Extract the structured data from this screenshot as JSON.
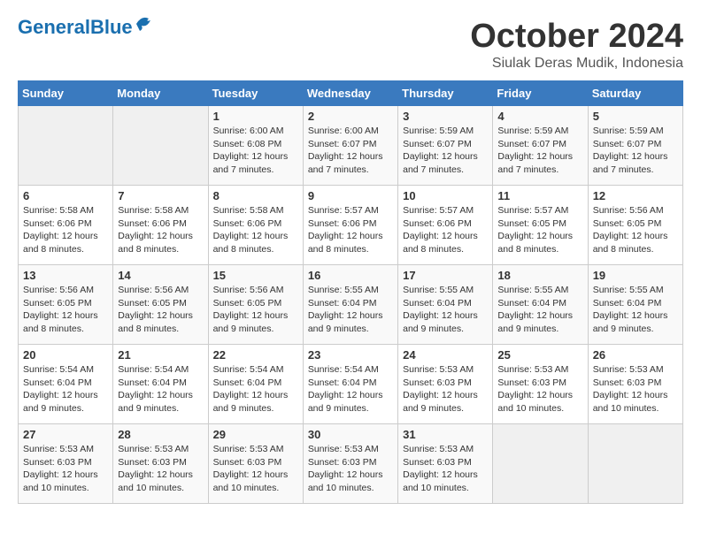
{
  "header": {
    "logo_general": "General",
    "logo_blue": "Blue",
    "month": "October 2024",
    "location": "Siulak Deras Mudik, Indonesia"
  },
  "weekdays": [
    "Sunday",
    "Monday",
    "Tuesday",
    "Wednesday",
    "Thursday",
    "Friday",
    "Saturday"
  ],
  "weeks": [
    [
      {
        "day": "",
        "sunrise": "",
        "sunset": "",
        "daylight": ""
      },
      {
        "day": "",
        "sunrise": "",
        "sunset": "",
        "daylight": ""
      },
      {
        "day": "1",
        "sunrise": "Sunrise: 6:00 AM",
        "sunset": "Sunset: 6:08 PM",
        "daylight": "Daylight: 12 hours and 7 minutes."
      },
      {
        "day": "2",
        "sunrise": "Sunrise: 6:00 AM",
        "sunset": "Sunset: 6:07 PM",
        "daylight": "Daylight: 12 hours and 7 minutes."
      },
      {
        "day": "3",
        "sunrise": "Sunrise: 5:59 AM",
        "sunset": "Sunset: 6:07 PM",
        "daylight": "Daylight: 12 hours and 7 minutes."
      },
      {
        "day": "4",
        "sunrise": "Sunrise: 5:59 AM",
        "sunset": "Sunset: 6:07 PM",
        "daylight": "Daylight: 12 hours and 7 minutes."
      },
      {
        "day": "5",
        "sunrise": "Sunrise: 5:59 AM",
        "sunset": "Sunset: 6:07 PM",
        "daylight": "Daylight: 12 hours and 7 minutes."
      }
    ],
    [
      {
        "day": "6",
        "sunrise": "Sunrise: 5:58 AM",
        "sunset": "Sunset: 6:06 PM",
        "daylight": "Daylight: 12 hours and 8 minutes."
      },
      {
        "day": "7",
        "sunrise": "Sunrise: 5:58 AM",
        "sunset": "Sunset: 6:06 PM",
        "daylight": "Daylight: 12 hours and 8 minutes."
      },
      {
        "day": "8",
        "sunrise": "Sunrise: 5:58 AM",
        "sunset": "Sunset: 6:06 PM",
        "daylight": "Daylight: 12 hours and 8 minutes."
      },
      {
        "day": "9",
        "sunrise": "Sunrise: 5:57 AM",
        "sunset": "Sunset: 6:06 PM",
        "daylight": "Daylight: 12 hours and 8 minutes."
      },
      {
        "day": "10",
        "sunrise": "Sunrise: 5:57 AM",
        "sunset": "Sunset: 6:06 PM",
        "daylight": "Daylight: 12 hours and 8 minutes."
      },
      {
        "day": "11",
        "sunrise": "Sunrise: 5:57 AM",
        "sunset": "Sunset: 6:05 PM",
        "daylight": "Daylight: 12 hours and 8 minutes."
      },
      {
        "day": "12",
        "sunrise": "Sunrise: 5:56 AM",
        "sunset": "Sunset: 6:05 PM",
        "daylight": "Daylight: 12 hours and 8 minutes."
      }
    ],
    [
      {
        "day": "13",
        "sunrise": "Sunrise: 5:56 AM",
        "sunset": "Sunset: 6:05 PM",
        "daylight": "Daylight: 12 hours and 8 minutes."
      },
      {
        "day": "14",
        "sunrise": "Sunrise: 5:56 AM",
        "sunset": "Sunset: 6:05 PM",
        "daylight": "Daylight: 12 hours and 8 minutes."
      },
      {
        "day": "15",
        "sunrise": "Sunrise: 5:56 AM",
        "sunset": "Sunset: 6:05 PM",
        "daylight": "Daylight: 12 hours and 9 minutes."
      },
      {
        "day": "16",
        "sunrise": "Sunrise: 5:55 AM",
        "sunset": "Sunset: 6:04 PM",
        "daylight": "Daylight: 12 hours and 9 minutes."
      },
      {
        "day": "17",
        "sunrise": "Sunrise: 5:55 AM",
        "sunset": "Sunset: 6:04 PM",
        "daylight": "Daylight: 12 hours and 9 minutes."
      },
      {
        "day": "18",
        "sunrise": "Sunrise: 5:55 AM",
        "sunset": "Sunset: 6:04 PM",
        "daylight": "Daylight: 12 hours and 9 minutes."
      },
      {
        "day": "19",
        "sunrise": "Sunrise: 5:55 AM",
        "sunset": "Sunset: 6:04 PM",
        "daylight": "Daylight: 12 hours and 9 minutes."
      }
    ],
    [
      {
        "day": "20",
        "sunrise": "Sunrise: 5:54 AM",
        "sunset": "Sunset: 6:04 PM",
        "daylight": "Daylight: 12 hours and 9 minutes."
      },
      {
        "day": "21",
        "sunrise": "Sunrise: 5:54 AM",
        "sunset": "Sunset: 6:04 PM",
        "daylight": "Daylight: 12 hours and 9 minutes."
      },
      {
        "day": "22",
        "sunrise": "Sunrise: 5:54 AM",
        "sunset": "Sunset: 6:04 PM",
        "daylight": "Daylight: 12 hours and 9 minutes."
      },
      {
        "day": "23",
        "sunrise": "Sunrise: 5:54 AM",
        "sunset": "Sunset: 6:04 PM",
        "daylight": "Daylight: 12 hours and 9 minutes."
      },
      {
        "day": "24",
        "sunrise": "Sunrise: 5:53 AM",
        "sunset": "Sunset: 6:03 PM",
        "daylight": "Daylight: 12 hours and 9 minutes."
      },
      {
        "day": "25",
        "sunrise": "Sunrise: 5:53 AM",
        "sunset": "Sunset: 6:03 PM",
        "daylight": "Daylight: 12 hours and 10 minutes."
      },
      {
        "day": "26",
        "sunrise": "Sunrise: 5:53 AM",
        "sunset": "Sunset: 6:03 PM",
        "daylight": "Daylight: 12 hours and 10 minutes."
      }
    ],
    [
      {
        "day": "27",
        "sunrise": "Sunrise: 5:53 AM",
        "sunset": "Sunset: 6:03 PM",
        "daylight": "Daylight: 12 hours and 10 minutes."
      },
      {
        "day": "28",
        "sunrise": "Sunrise: 5:53 AM",
        "sunset": "Sunset: 6:03 PM",
        "daylight": "Daylight: 12 hours and 10 minutes."
      },
      {
        "day": "29",
        "sunrise": "Sunrise: 5:53 AM",
        "sunset": "Sunset: 6:03 PM",
        "daylight": "Daylight: 12 hours and 10 minutes."
      },
      {
        "day": "30",
        "sunrise": "Sunrise: 5:53 AM",
        "sunset": "Sunset: 6:03 PM",
        "daylight": "Daylight: 12 hours and 10 minutes."
      },
      {
        "day": "31",
        "sunrise": "Sunrise: 5:53 AM",
        "sunset": "Sunset: 6:03 PM",
        "daylight": "Daylight: 12 hours and 10 minutes."
      },
      {
        "day": "",
        "sunrise": "",
        "sunset": "",
        "daylight": ""
      },
      {
        "day": "",
        "sunrise": "",
        "sunset": "",
        "daylight": ""
      }
    ]
  ]
}
